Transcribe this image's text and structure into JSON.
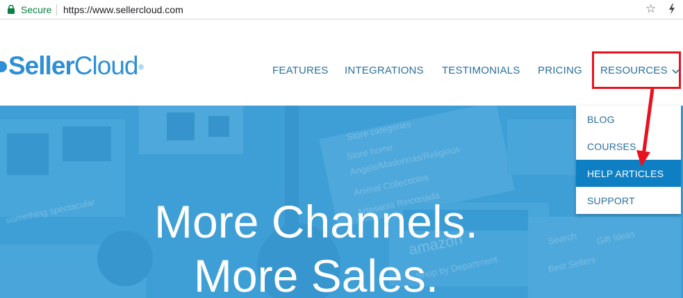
{
  "browser": {
    "secure_label": "Secure",
    "url": "https://www.sellercloud.com"
  },
  "site": {
    "logo": {
      "part1": "Seller",
      "part2": "Cloud",
      "reg": "®"
    },
    "nav": {
      "features": "FEATURES",
      "integrations": "INTEGRATIONS",
      "testimonials": "TESTIMONIALS",
      "pricing": "PRICING",
      "resources": "RESOURCES"
    },
    "resources_menu": {
      "blog": "BLOG",
      "courses": "COURSES",
      "help_articles": "HELP ARTICLES",
      "support": "SUPPORT"
    },
    "hero": {
      "line1": "More Channels.",
      "line2": "More Sales."
    }
  },
  "colors": {
    "brand": "#2d8fd5",
    "nav_text": "#2a6f9e",
    "hero_bg": "#3d9fd6",
    "menu_highlight": "#0e7fc3",
    "annotation_red": "#e8121e",
    "secure_green": "#0b8043"
  },
  "icons": {
    "lock": "lock-icon",
    "star": "star-icon",
    "bolt": "bolt-icon",
    "chevron": "chevron-down-icon"
  }
}
